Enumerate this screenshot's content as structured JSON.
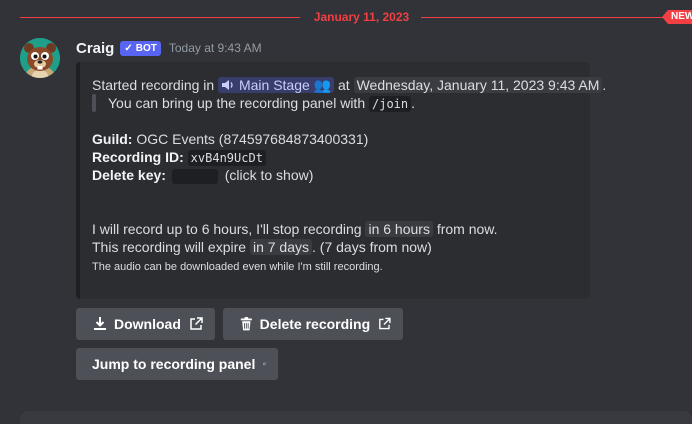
{
  "divider": {
    "date": "January 11, 2023",
    "new_label": "NEW"
  },
  "message": {
    "username": "Craig",
    "bot_tag": "BOT",
    "bot_check": "✓",
    "timestamp": "Today at 9:43 AM",
    "avatar_icon": "beaver-avatar"
  },
  "embed": {
    "started_prefix": "Started recording in",
    "channel_icon": "speaker-icon",
    "channel_name": "Main Stage",
    "channel_emoji": "👥",
    "at_word": "at",
    "start_time": "Wednesday, January 11, 2023 9:43 AM",
    "period": ".",
    "panel_text": "You can bring up the recording panel with",
    "join_command": "/join",
    "panel_period": ".",
    "guild_label": "Guild:",
    "guild_value": "OGC Events (874597684873400331)",
    "recording_id_label": "Recording ID:",
    "recording_id_value": "xvB4n9UcDt",
    "delete_key_label": "Delete key:",
    "delete_key_hint": "(click to show)",
    "record_limit_prefix": "I will record up to 6 hours, I'll stop recording",
    "record_limit_time": "in 6 hours",
    "record_limit_suffix": "from now.",
    "expire_prefix": "This recording will expire",
    "expire_time": "in 7 days",
    "expire_suffix": ". (7 days from now)",
    "download_note": "The audio can be downloaded even while I'm still recording."
  },
  "buttons": {
    "download": "Download",
    "delete": "Delete recording",
    "jump": "Jump to recording panel"
  },
  "colors": {
    "accent_red": "#f23f43",
    "bot_blue": "#5865f2",
    "background": "#313338",
    "embed_bg": "#2b2d31",
    "button_bg": "#4e5058"
  }
}
